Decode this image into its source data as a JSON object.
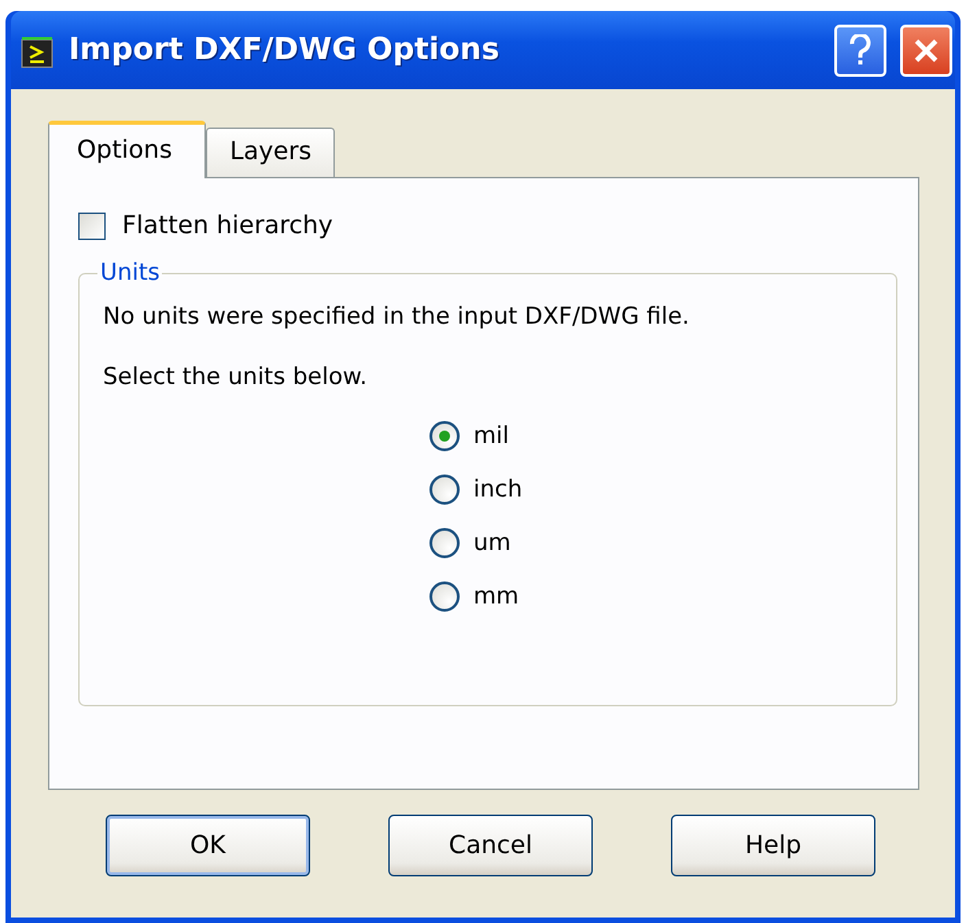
{
  "window": {
    "title": "Import DXF/DWG Options"
  },
  "tabs": [
    {
      "label": "Options",
      "selected": true
    },
    {
      "label": "Layers",
      "selected": false
    }
  ],
  "flatten": {
    "label": "Flatten hierarchy",
    "checked": false
  },
  "units": {
    "legend": "Units",
    "message": "No units were specified in the input DXF/DWG file.",
    "prompt": "Select the units below.",
    "options": [
      {
        "label": "mil",
        "selected": true
      },
      {
        "label": "inch",
        "selected": false
      },
      {
        "label": "um",
        "selected": false
      },
      {
        "label": "mm",
        "selected": false
      }
    ]
  },
  "buttons": [
    {
      "label": "OK",
      "default": true
    },
    {
      "label": "Cancel",
      "default": false
    },
    {
      "label": "Help",
      "default": false
    }
  ]
}
